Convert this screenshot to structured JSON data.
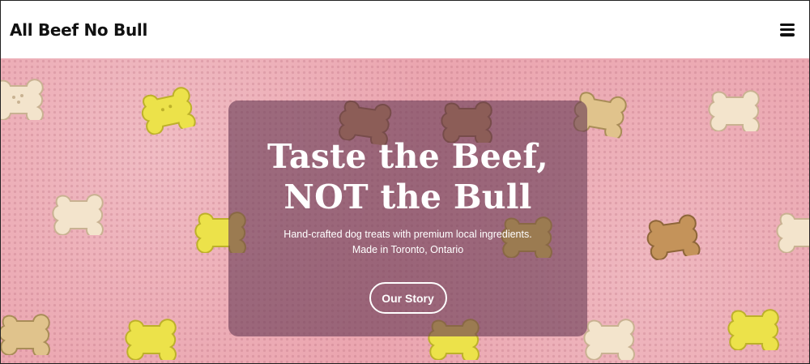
{
  "header": {
    "logo_text": "All Beef No Bull",
    "menu_icon": "hamburger-menu-icon"
  },
  "hero": {
    "title_line1": "Taste the Beef,",
    "title_line2": "NOT the Bull",
    "subtitle_line1": "Hand-crafted dog treats with premium local ingredients.",
    "subtitle_line2": "Made in Toronto, Ontario",
    "cta_label": "Our Story",
    "background_color": "#eba6b0",
    "overlay_color": "#693c55"
  }
}
